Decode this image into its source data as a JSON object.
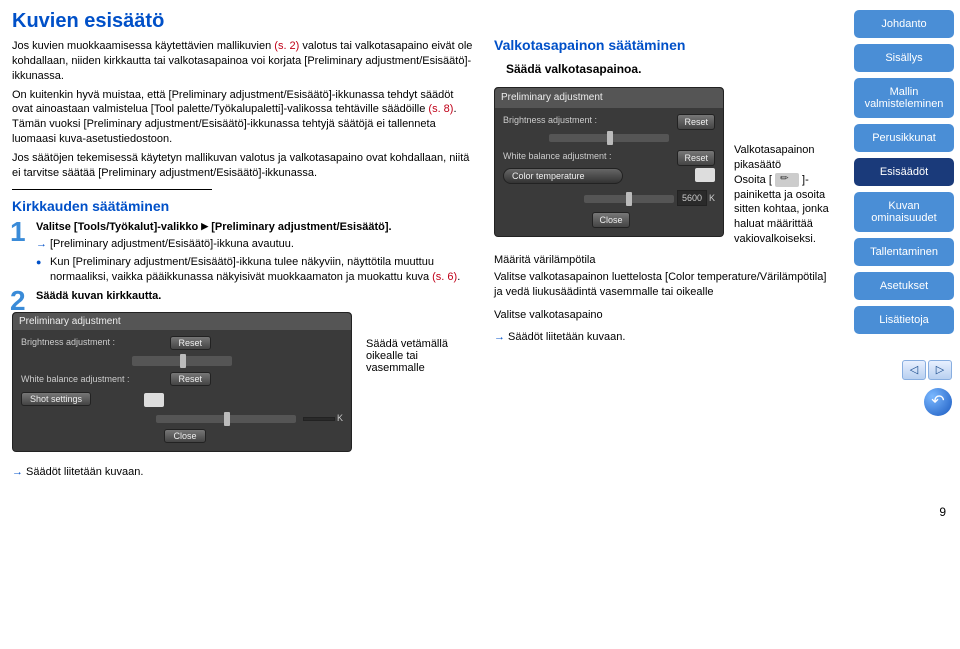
{
  "title": "Kuvien esisäätö",
  "intro1_a": "Jos kuvien muokkaamisessa käytettävien mallikuvien ",
  "intro1_ref": "(s. 2)",
  "intro1_b": " valotus tai valkotasapaino eivät ole kohdallaan, niiden kirkkautta tai valkotasapainoa voi korjata [Preliminary adjustment/Esisäätö]-ikkunassa.",
  "intro2_a": "On kuitenkin hyvä muistaa, että [Preliminary adjustment/Esisäätö]-ikkunassa tehdyt säädöt ovat ainoastaan valmistelua [Tool palette/Työkalupaletti]-valikossa tehtäville säädöille ",
  "intro2_ref": "(s. 8)",
  "intro2_b": ". Tämän vuoksi [Preliminary adjustment/Esisäätö]-ikkunassa tehtyjä säätöjä ei tallenneta luomaasi kuva-asetustiedostoon.",
  "intro3": "Jos säätöjen tekemisessä käytetyn mallikuvan valotus ja valkotasapaino ovat kohdallaan, niitä ei tarvitse säätää [Preliminary adjustment/Esisäätö]-ikkunassa.",
  "s1_h": "Kirkkauden säätäminen",
  "s1_step1_a": "Valitse [Tools/Työkalut]-valikko ",
  "s1_step1_b": " [Preliminary adjustment/Esisäätö].",
  "s1_step1_arrow": "[Preliminary adjustment/Esisäätö]-ikkuna avautuu.",
  "s1_step1_bullet_a": "Kun [Preliminary adjustment/Esisäätö]-ikkuna tulee näkyviin, näyttötila muuttuu normaaliksi, vaikka pääikkunassa näkyisivät muokkaamaton ja muokattu kuva ",
  "s1_step1_bullet_ref": "(s. 6)",
  "s1_step1_bullet_b": ".",
  "s1_step2": "Säädä kuvan kirkkautta.",
  "s1_annot": "Säädä vetämällä oikealle tai vasemmalle",
  "s1_arrow2": "Säädöt liitetään kuvaan.",
  "panel": {
    "title": "Preliminary adjustment",
    "brightness": "Brightness adjustment :",
    "wb": "White balance adjustment :",
    "reset": "Reset",
    "shot": "Shot settings",
    "close": "Close",
    "k": "K"
  },
  "r_h": "Valkotasapainon säätäminen",
  "r_sub": "Säädä valkotasapainoa.",
  "r_cap_h": "Valkotasapainon pikasäätö",
  "r_cap_a": "Osoita [ ",
  "r_cap_b": " ]-painiketta ja osoita sitten kohtaa, jonka haluat määrittää vakiovalkoiseksi.",
  "r_cap2_h": "Määritä värilämpötila",
  "r_cap2": "Valitse valkotasapainon luettelosta [Color temperature/Värilämpötila] ja vedä liukusäädintä vasemmalle tai oikealle",
  "r_cap3": "Valitse valkotasapaino",
  "r_arrow": "Säädöt liitetään kuvaan.",
  "panel2": {
    "title": "Preliminary adjustment",
    "brightness": "Brightness adjustment :",
    "wb": "White balance adjustment :",
    "reset": "Reset",
    "ct": "Color temperature",
    "close": "Close",
    "k": "K",
    "kval": "5600"
  },
  "sidebar": {
    "items": [
      "Johdanto",
      "Sisällys",
      "Mallin valmisteleminen",
      "Perusikkunat",
      "Esisäädöt",
      "Kuvan ominaisuudet",
      "Tallentaminen",
      "Asetukset",
      "Lisätietoja"
    ]
  },
  "pagenum": "9"
}
